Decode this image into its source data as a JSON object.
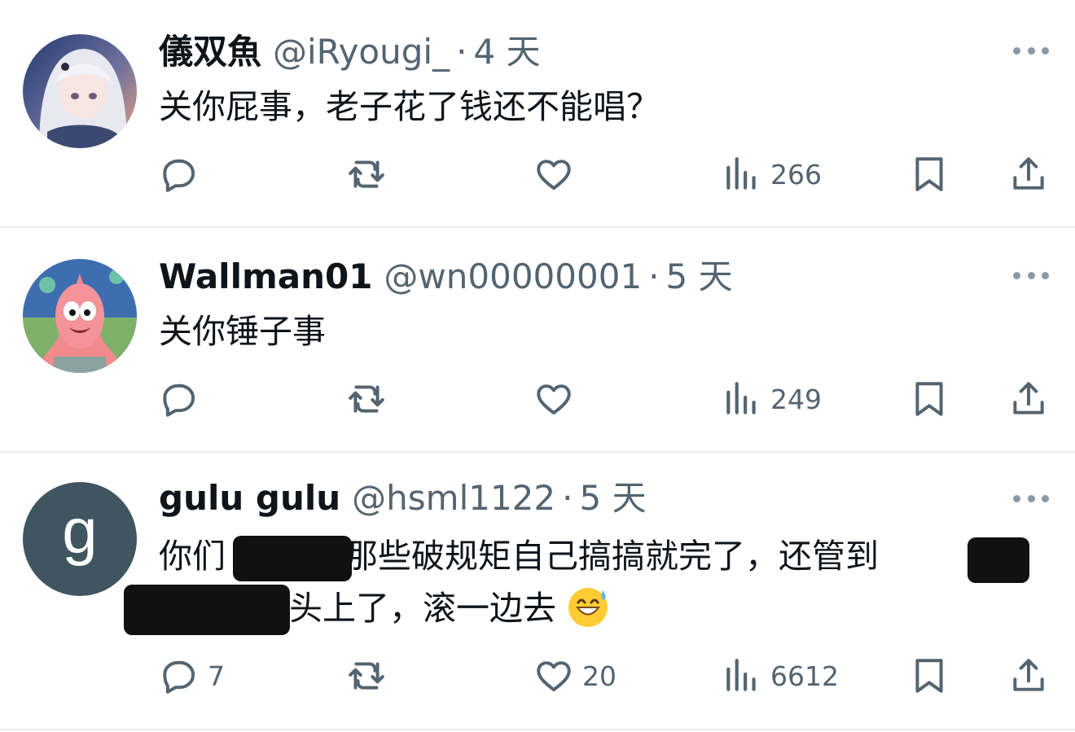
{
  "tweets": [
    {
      "display_name": "儀双魚",
      "handle": "@iRyougi_",
      "separator": "·",
      "time": "4 天",
      "text_line1": "关你屁事，老子花了钱还不能唱？",
      "reply_count": "",
      "retweet_count": "",
      "like_count": "",
      "view_count": "266",
      "avatar_icon": "anime-girl-avatar"
    },
    {
      "display_name": "Wallman01",
      "handle": "@wn00000001",
      "separator": "·",
      "time": "5 天",
      "text_line1": "关你锤子事",
      "reply_count": "",
      "retweet_count": "",
      "like_count": "",
      "view_count": "249",
      "avatar_icon": "patrick-star-avatar"
    },
    {
      "display_name": "gulu gulu",
      "handle": "@hsml1122",
      "separator": "·",
      "time": "5 天",
      "text_line1_part1": "你们",
      "text_line1_part2": "那些破规矩自己搞搞就完了，还管到",
      "text_line2": "头上了，滚一边去",
      "avatar_letter": "g",
      "reply_count": "7",
      "retweet_count": "",
      "like_count": "20",
      "view_count": "6612",
      "emoji": "grinning-sweat-emoji"
    }
  ],
  "colors": {
    "text": "#0f1419",
    "secondary": "#536471",
    "divider": "#e6ecf0",
    "avatar_g": "#3f5560"
  },
  "icons": [
    "reply-icon",
    "retweet-icon",
    "like-icon",
    "views-icon",
    "bookmark-icon",
    "share-icon",
    "more-icon"
  ]
}
